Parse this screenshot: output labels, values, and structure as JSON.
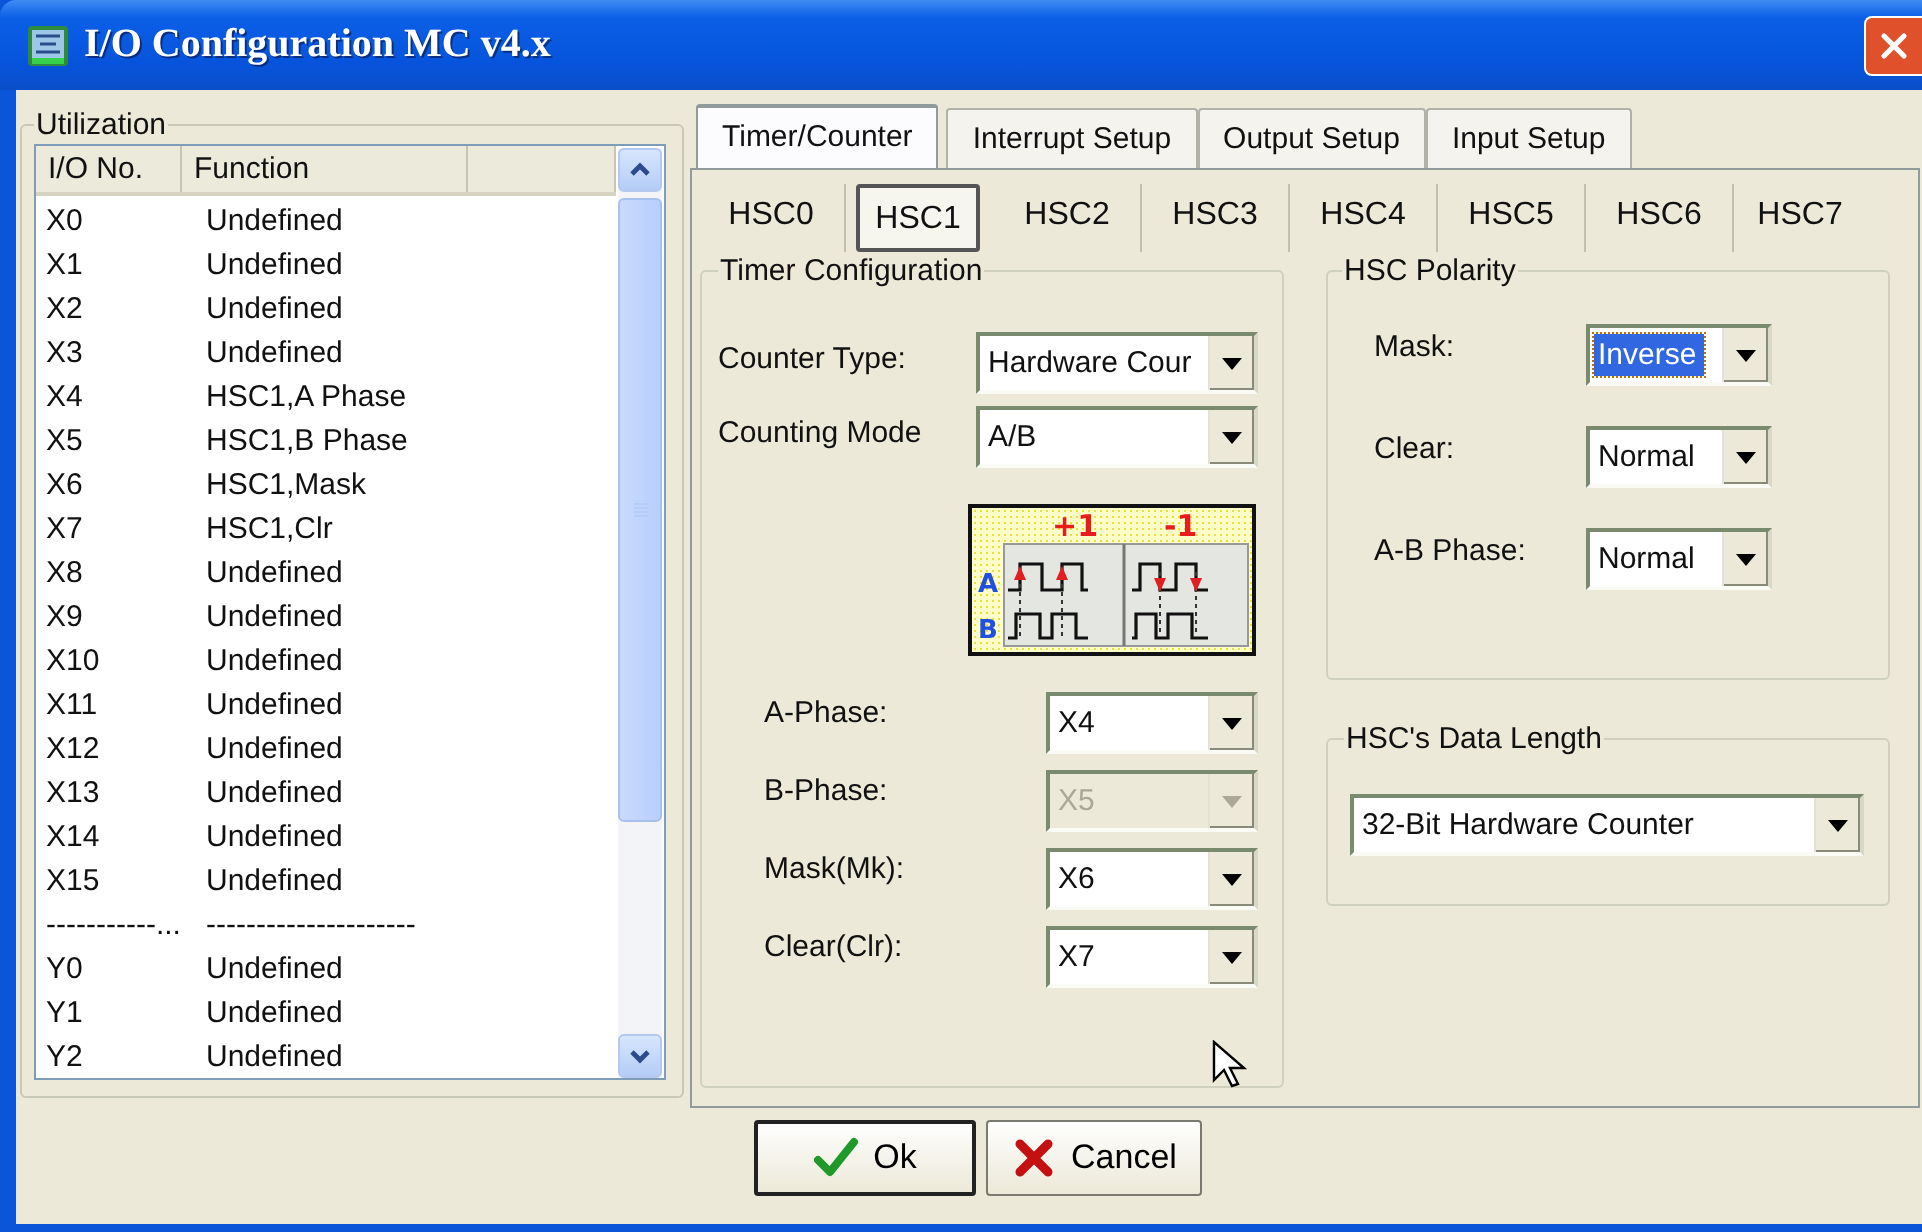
{
  "window": {
    "title": "I/O Configuration MC v4.x"
  },
  "utilization": {
    "title": "Utilization",
    "columns": [
      "I/O No.",
      "Function"
    ],
    "rows": [
      {
        "io": "X0",
        "function": "Undefined"
      },
      {
        "io": "X1",
        "function": "Undefined"
      },
      {
        "io": "X2",
        "function": "Undefined"
      },
      {
        "io": "X3",
        "function": "Undefined"
      },
      {
        "io": "X4",
        "function": "HSC1,A Phase"
      },
      {
        "io": "X5",
        "function": "HSC1,B Phase"
      },
      {
        "io": "X6",
        "function": "HSC1,Mask"
      },
      {
        "io": "X7",
        "function": "HSC1,Clr"
      },
      {
        "io": "X8",
        "function": "Undefined"
      },
      {
        "io": "X9",
        "function": "Undefined"
      },
      {
        "io": "X10",
        "function": "Undefined"
      },
      {
        "io": "X11",
        "function": "Undefined"
      },
      {
        "io": "X12",
        "function": "Undefined"
      },
      {
        "io": "X13",
        "function": "Undefined"
      },
      {
        "io": "X14",
        "function": "Undefined"
      },
      {
        "io": "X15",
        "function": "Undefined"
      },
      {
        "io": "-----------...",
        "function": "---------------------"
      },
      {
        "io": "Y0",
        "function": "Undefined"
      },
      {
        "io": "Y1",
        "function": "Undefined"
      },
      {
        "io": "Y2",
        "function": "Undefined"
      }
    ]
  },
  "tabs": [
    {
      "label": "Timer/Counter",
      "selected": true
    },
    {
      "label": "Interrupt Setup",
      "selected": false
    },
    {
      "label": "Output Setup",
      "selected": false
    },
    {
      "label": "Input Setup",
      "selected": false
    }
  ],
  "subtabs": [
    {
      "label": "HSC0",
      "selected": false
    },
    {
      "label": "HSC1",
      "selected": true
    },
    {
      "label": "HSC2",
      "selected": false
    },
    {
      "label": "HSC3",
      "selected": false
    },
    {
      "label": "HSC4",
      "selected": false
    },
    {
      "label": "HSC5",
      "selected": false
    },
    {
      "label": "HSC6",
      "selected": false
    },
    {
      "label": "HSC7",
      "selected": false
    }
  ],
  "timer_configuration": {
    "title": "Timer Configuration",
    "counter_type": {
      "label": "Counter Type:",
      "value": "Hardware Cour"
    },
    "counting_mode": {
      "label": "Counting Mode",
      "value": "A/B"
    },
    "diagram": {
      "increment": "+1",
      "decrement": "-1",
      "channel_a": "A",
      "channel_b": "B"
    },
    "inputs": [
      {
        "label": "A-Phase:",
        "value": "X4",
        "disabled": false
      },
      {
        "label": "B-Phase:",
        "value": "X5",
        "disabled": true
      },
      {
        "label": "Mask(Mk):",
        "value": "X6",
        "disabled": false
      },
      {
        "label": "Clear(Clr):",
        "value": "X7",
        "disabled": false
      }
    ]
  },
  "hsc_polarity": {
    "title": "HSC Polarity",
    "fields": [
      {
        "label": "Mask:",
        "value": "Inverse",
        "focused": true
      },
      {
        "label": "Clear:",
        "value": "Normal",
        "focused": false
      },
      {
        "label": "A-B Phase:",
        "value": "Normal",
        "focused": false
      }
    ]
  },
  "data_length": {
    "title": "HSC's Data Length",
    "value": "32-Bit Hardware Counter"
  },
  "buttons": [
    {
      "kind": "ok",
      "label": "Ok"
    },
    {
      "kind": "cancel",
      "label": "Cancel"
    }
  ]
}
